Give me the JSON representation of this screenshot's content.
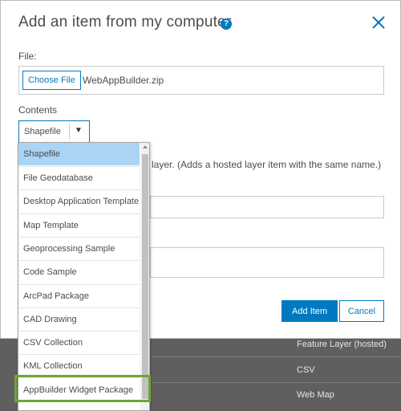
{
  "dialog": {
    "title": "Add an item from my computer",
    "help_glyph": "?",
    "file_label": "File:",
    "choose_file_label": "Choose File",
    "file_name": "WebAppBuilder.zip",
    "contents_label": "Contents",
    "contents_selected": "Shapefile",
    "select_arrow": "▼",
    "publish_description": "layer. (Adds a hosted layer item with the same name.)",
    "add_item_label": "Add Item",
    "cancel_label": "Cancel"
  },
  "dropdown": {
    "items": [
      "Shapefile",
      "File Geodatabase",
      "Desktop Application Template",
      "Map Template",
      "Geoprocessing Sample",
      "Code Sample",
      "ArcPad Package",
      "CAD Drawing",
      "CSV Collection",
      "KML Collection",
      "AppBuilder Widget Package"
    ],
    "selected_index": 0,
    "highlighted_index": 10
  },
  "background_list": {
    "rows": [
      "Feature Layer (hosted)",
      "CSV",
      "Web Map"
    ]
  },
  "colors": {
    "accent": "#0079c1",
    "selected_item": "#a9d4f5",
    "highlight_outline": "#6fa43a",
    "overlay_bg": "#5f5f5f"
  }
}
